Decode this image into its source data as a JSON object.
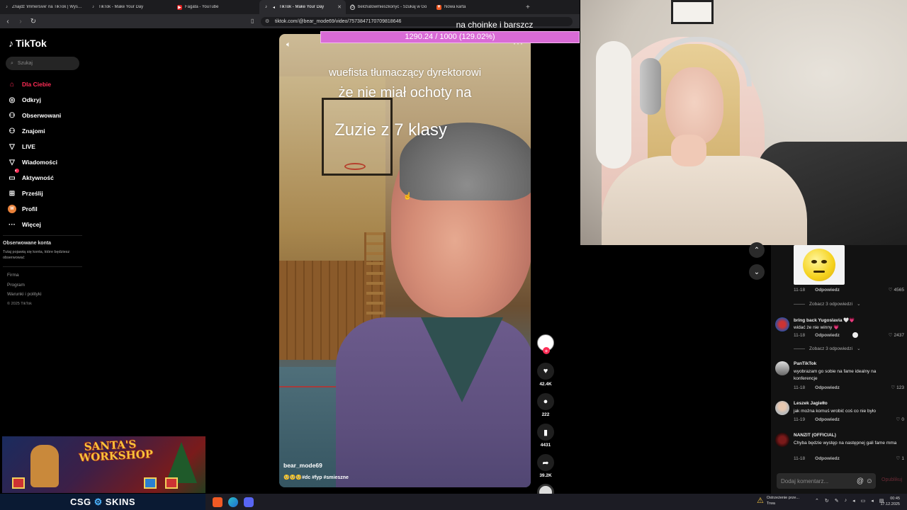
{
  "browser": {
    "tabs": [
      {
        "label": "Znajdź 'immersive' na TikTok | Wyszu",
        "icon": "tiktok-icon",
        "active": false
      },
      {
        "label": "TikTok - Make Your Day",
        "icon": "tiktok-icon",
        "active": false
      },
      {
        "label": "Fagata - YouTube",
        "icon": "youtube-icon",
        "active": false
      },
      {
        "label": "TikTok - Make Your Day",
        "icon": "tiktok-icon",
        "active": true
      },
      {
        "label": "belchatowmieszkonyc - Szukaj w Go",
        "icon": "google-icon",
        "active": false
      },
      {
        "label": "Nowa karta",
        "icon": "brave-icon",
        "active": false
      }
    ],
    "new_tab": "+",
    "url": "tiktok.com/@bear_mode69/video/7573847170709818646"
  },
  "sidebar": {
    "logo": "TikTok",
    "search_placeholder": "Szukaj",
    "items": [
      {
        "label": "Dla Ciebie",
        "icon": "home-icon",
        "glyph": "⌂"
      },
      {
        "label": "Odkryj",
        "icon": "compass-icon",
        "glyph": "◎"
      },
      {
        "label": "Obserwowani",
        "icon": "user-follow-icon",
        "glyph": "⚇"
      },
      {
        "label": "Znajomi",
        "icon": "friends-icon",
        "glyph": "⚇"
      },
      {
        "label": "LIVE",
        "icon": "live-icon",
        "glyph": "▽"
      },
      {
        "label": "Wiadomości",
        "icon": "messages-icon",
        "glyph": "▽"
      },
      {
        "label": "Aktywność",
        "icon": "activity-icon",
        "glyph": "▭"
      },
      {
        "label": "Prześlij",
        "icon": "upload-icon",
        "glyph": "⊞"
      },
      {
        "label": "Profil",
        "icon": "profile-avatar-icon",
        "glyph": "W"
      },
      {
        "label": "Więcej",
        "icon": "more-icon",
        "glyph": "···"
      }
    ],
    "activity_badge": "9",
    "followed_title": "Obserwowane konta",
    "followed_desc": "Tutaj pojawią się konta, które będziesz obserwować",
    "footer": [
      "Firma",
      "Program",
      "Warunki i polityki"
    ],
    "copyright": "© 2025 TikTok"
  },
  "banner": {
    "title": "SANTA'S WORKSHOP",
    "sponsor_left": "CSG",
    "sponsor_right": "SKINS"
  },
  "video": {
    "caption_line1": "wuefista tłumaczący dyrektorowi",
    "caption_line2": "że nie miał ochoty na",
    "caption_line3": "Zuzie z 7 klasy",
    "author": "bear_mode69",
    "hashtags": "🥺🥺🥺#dc #fyp #smieszne"
  },
  "donation": {
    "title": "na choinke i barszcz",
    "progress_text": "1290.24 / 1000 (129.02%)",
    "progress": 1.2902
  },
  "actions": {
    "likes": "42.4K",
    "comments": "222",
    "saves": "4431",
    "shares": "39.2K"
  },
  "comments": {
    "first": {
      "date": "11-18",
      "reply": "Odpowiedz",
      "likes": "4565"
    },
    "see_replies_1": "Zobacz 3 odpowiedzi",
    "list": [
      {
        "name": "bring back Yugoslavia 🤍💗",
        "text": "widać że nie winny 💗",
        "date": "11-18",
        "reply": "Odpowiedz",
        "likes": "2437",
        "avatar_color": "#3a5aa8"
      },
      {
        "name": "PanTikTok",
        "text": "wyobrazam go sobie na fame idealny na konferencje",
        "date": "11-18",
        "reply": "Odpowiedz",
        "likes": "123",
        "avatar_color": "#888"
      },
      {
        "name": "Leszek Jagiełło",
        "text": "jak można komuś wrobić coś co nie było",
        "date": "11-19",
        "reply": "Odpowiedz",
        "likes": "0",
        "avatar_color": "#cfcfcf"
      },
      {
        "name": "NANZIT (OFFICIAL)",
        "text": "Chyba będzie występ na następnej gali fame mma",
        "date": "11-18",
        "reply": "Odpowiedz",
        "likes": "1",
        "avatar_color": "#5a1a1a"
      }
    ],
    "see_replies_2": "Zobacz 3 odpowiedzi",
    "input_placeholder": "Dodaj komentarz...",
    "post_label": "Opublikuj"
  },
  "taskbar": {
    "warning_title": "Ostrzeżenie prze...",
    "warning_sub": "Trwa",
    "time": "00:45",
    "date": "17.12.2025"
  }
}
